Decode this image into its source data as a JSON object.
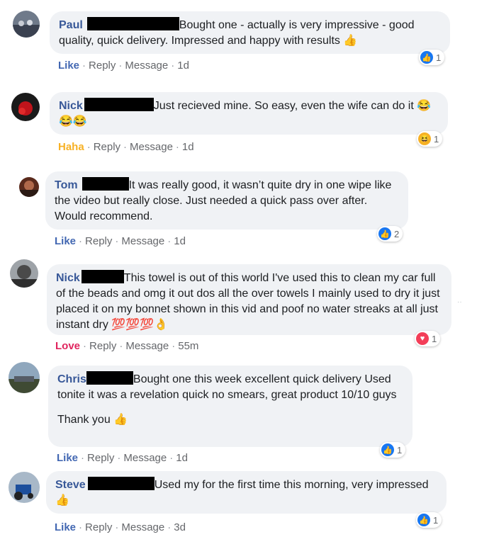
{
  "comments": [
    {
      "author": "Paul",
      "text": "Bought one - actually is very impressive - good quality, quick delivery. Impressed and happy with results",
      "emoji": "👍",
      "reaction": "Like",
      "reply": "Reply",
      "message": "Message",
      "time": "1d",
      "reaction_count": "1",
      "reaction_icon": "like-icon"
    },
    {
      "author": "Nick",
      "text": "Just recieved mine. So easy, even the wife can do it",
      "emoji": "😂😂😂",
      "reaction": "Haha",
      "reply": "Reply",
      "message": "Message",
      "time": "1d",
      "reaction_count": "1",
      "reaction_icon": "haha-icon"
    },
    {
      "author": "Tom",
      "text": "It was really good, it wasn’t quite dry in one wipe like the video but really close. Just needed a quick pass over after. Would recommend.",
      "reaction": "Like",
      "reply": "Reply",
      "message": "Message",
      "time": "1d",
      "reaction_count": "2",
      "reaction_icon": "like-icon"
    },
    {
      "author": "Nick",
      "text": "This towel is out of this world I've used this to clean my car full of the beads and omg it out dos all the over towels I mainly used to dry it just placed it on my bonnet shown in this vid and poof no water streaks at all just instant dry",
      "emoji": "💯💯💯👌",
      "reaction": "Love",
      "reply": "Reply",
      "message": "Message",
      "time": "55m",
      "reaction_count": "1",
      "reaction_icon": "love-icon"
    },
    {
      "author": "Chris",
      "text": "Bought one this week excellent quick delivery Used tonite it was a revelation quick no smears, great product 10/10 guys",
      "text2": "Thank you",
      "emoji": "👍",
      "reaction": "Like",
      "reply": "Reply",
      "message": "Message",
      "time": "1d",
      "reaction_count": "1",
      "reaction_icon": "like-icon"
    },
    {
      "author": "Steve",
      "text": "Used my for the first time this morning, very impressed",
      "emoji": "👍",
      "reaction": "Like",
      "reply": "Reply",
      "message": "Message",
      "time": "3d",
      "reaction_count": "1",
      "reaction_icon": "like-icon"
    }
  ],
  "colors": {
    "bubble": "#f0f2f5",
    "author": "#385898",
    "like": "#4267b2",
    "haha": "#f7b125",
    "love": "#e0245e",
    "meta": "#65676b"
  }
}
